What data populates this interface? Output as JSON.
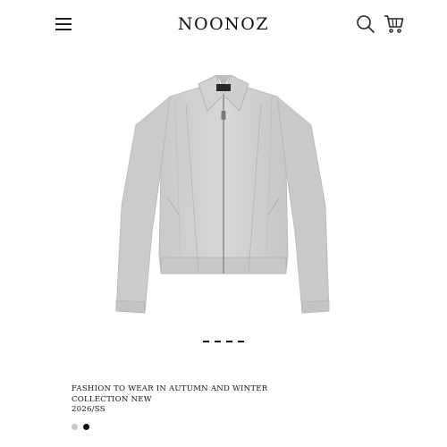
{
  "header": {
    "brand": "NOONOZ",
    "menu_icon": "hamburger-menu-icon",
    "search_icon": "search-icon",
    "cart_icon": "cart-icon"
  },
  "product": {
    "image_alt": "gray zip jacket",
    "description_line1": "FASHION TO WEAR IN AUTUMN AND WINTER",
    "description_line2": "COLLECTION NEW",
    "season": "2026/SS",
    "colors": [
      "#c8c8c8",
      "#111111"
    ]
  },
  "gallery": {
    "slide_count": 4
  }
}
